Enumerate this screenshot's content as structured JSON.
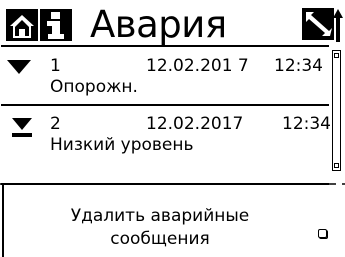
{
  "header": {
    "title": "Авария",
    "home_icon": "home-icon",
    "info_icon": "info-icon",
    "resize_icon": "resize-arrows-icon"
  },
  "alarms": [
    {
      "icon": "triangle-down-icon",
      "number": "1",
      "date": "12.02.201 7",
      "time": "12:34",
      "text": "Опорожн."
    },
    {
      "icon": "triangle-down-bar-icon",
      "number": "2",
      "date": "12.02.2017",
      "time": "12:34",
      "text": "Низкий уровень"
    }
  ],
  "delete_option": {
    "label_line1": "Удалить аварийные",
    "label_line2": "сообщения",
    "checked": false
  },
  "colors": {
    "foreground": "#000000",
    "background": "#ffffff"
  }
}
